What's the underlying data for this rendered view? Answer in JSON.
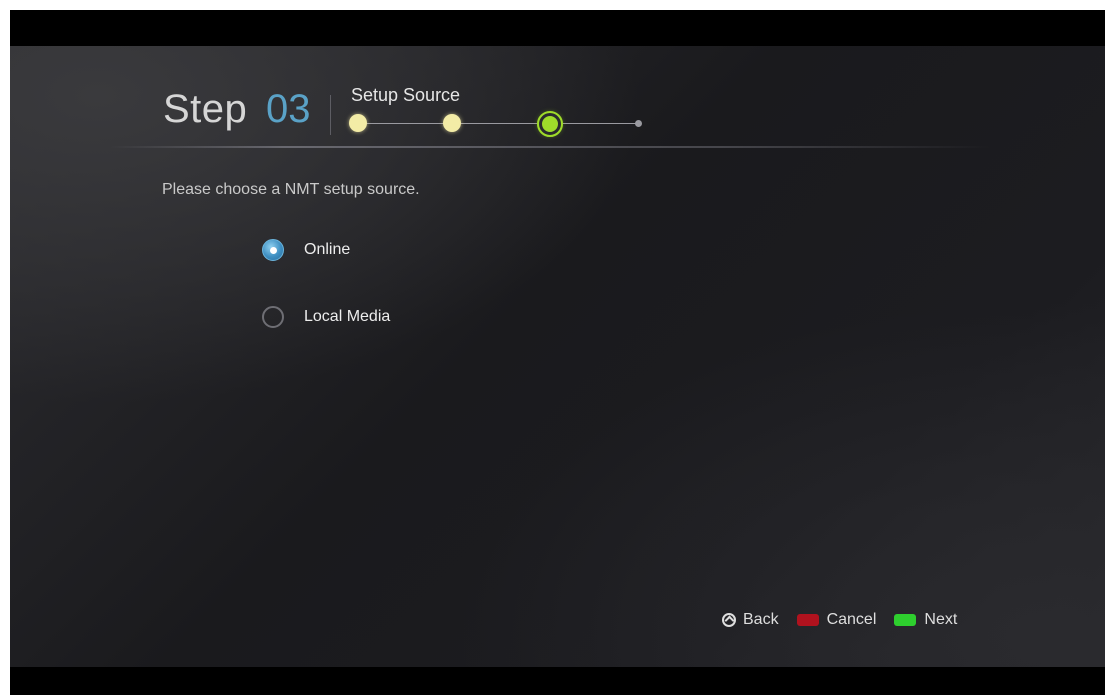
{
  "header": {
    "step_word": "Step",
    "step_number": "03",
    "step_title": "Setup Source",
    "progress": {
      "total_steps": 4,
      "current_step": 3
    }
  },
  "instruction": "Please choose a NMT setup source.",
  "options": [
    {
      "label": "Online",
      "selected": true
    },
    {
      "label": "Local Media",
      "selected": false
    }
  ],
  "footer": {
    "back_label": "Back",
    "cancel_label": "Cancel",
    "next_label": "Next",
    "back_icon": "back-circle-icon"
  },
  "colors": {
    "accent_blue": "#5aa2c7",
    "progress_done": "#f3eca6",
    "progress_current": "#9fdc2a",
    "cancel_key": "#b0121e",
    "next_key": "#2ecf2e"
  }
}
